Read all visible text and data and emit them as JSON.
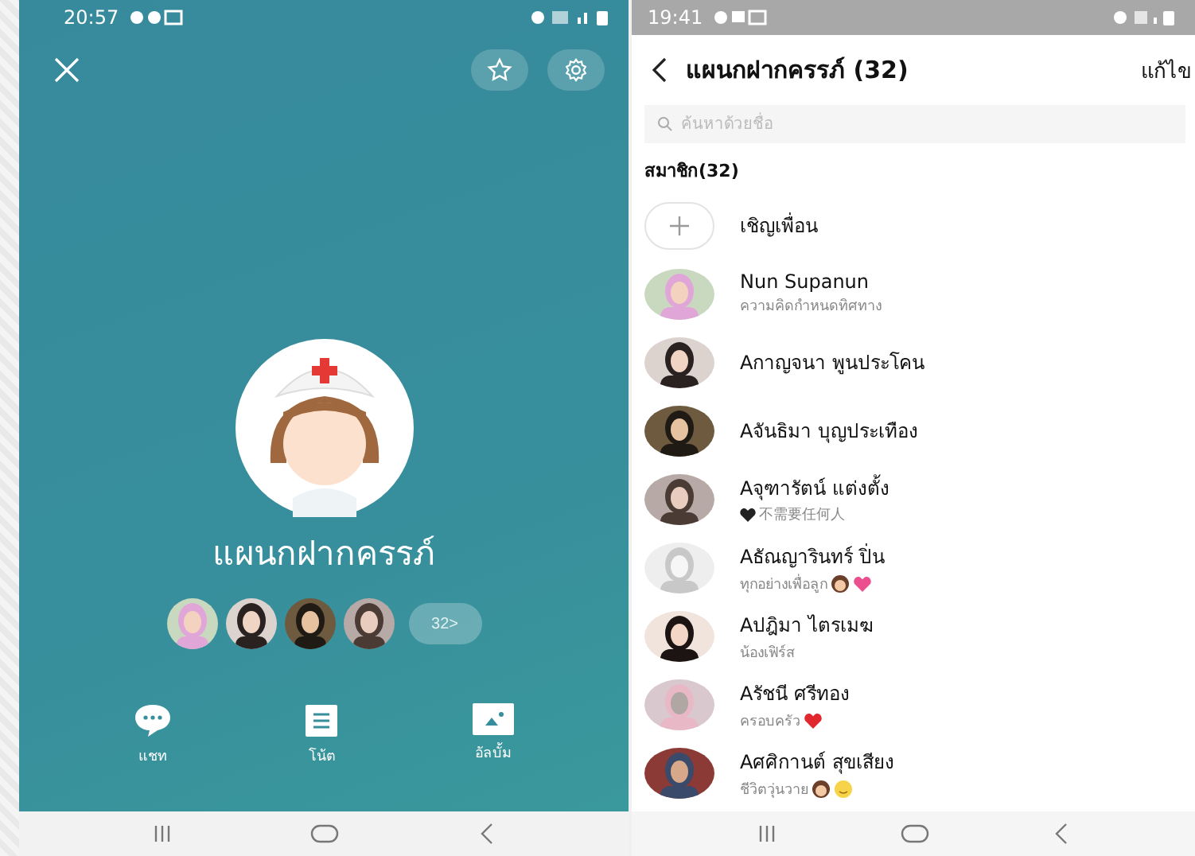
{
  "group_profile": {
    "status_bar": {
      "time": "20:57"
    },
    "name": "แผนกฝากครรภ์",
    "member_count_button": "32>",
    "actions": [
      {
        "kind": "chat",
        "label": "แชท"
      },
      {
        "kind": "note",
        "label": "โน้ต"
      },
      {
        "kind": "album",
        "label": "อัลบั้ม"
      }
    ]
  },
  "member_list": {
    "status_bar": {
      "time": "19:41"
    },
    "title": "แผนกฝากครรภ์ (32)",
    "edit_link": "แก้ไข",
    "search": {
      "placeholder": "ค้นหาด้วยชื่อ"
    },
    "section_heading": "สมาชิก(32)",
    "invite": "เชิญเพื่อน",
    "members": [
      {
        "name": "Nun Supanun",
        "status": "ความคิดกำหนดทิศทาง"
      },
      {
        "name": "Aกาญจนา พูนประโคน"
      },
      {
        "name": "Aจันธิมา บุญประเทือง"
      },
      {
        "name": "Aจุฑารัตน์ แต่งตั้ง",
        "status": "不需要任何人",
        "status_icons_before": [
          {
            "kind": "black-heart"
          }
        ]
      },
      {
        "name": "Aธัณญารินทร์ ปิ่น",
        "status": "ทุกอย่างเพื่อลูก",
        "status_icons": [
          {
            "kind": "girl"
          },
          {
            "kind": "pink-heart"
          }
        ]
      },
      {
        "name": "Aปฎิมา ไตรเมฆ",
        "status": "น้องเฟิร์ส"
      },
      {
        "name": "Aรัชนี ศรีทอง",
        "status": "ครอบครัว",
        "status_icons": [
          {
            "kind": "red-heart"
          }
        ]
      },
      {
        "name": "Aศศิกานต์ สุขเสียง",
        "status": "ชีวิตวุ่นวาย",
        "status_icons": [
          {
            "kind": "girl"
          },
          {
            "kind": "smiley"
          }
        ]
      }
    ]
  }
}
